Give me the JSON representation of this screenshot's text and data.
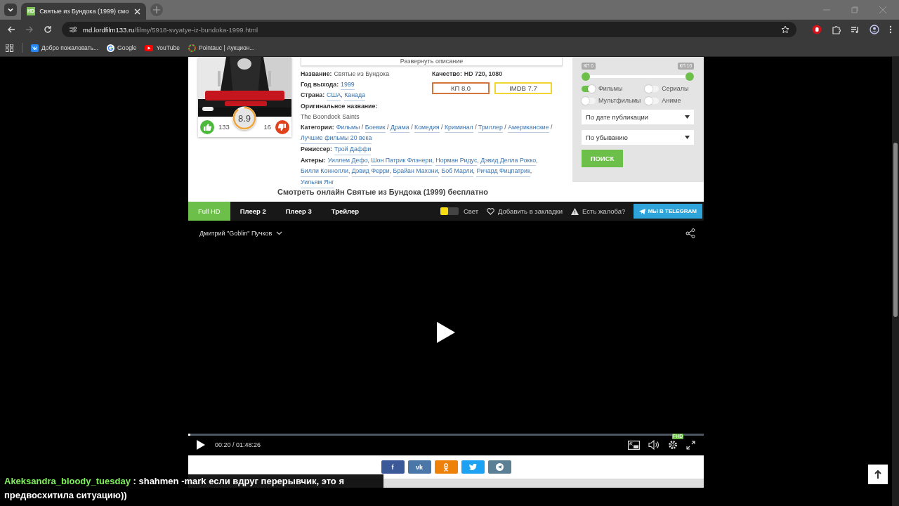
{
  "browser": {
    "tab_title": "Святые из Бундока (1999) смо",
    "tab_favicon": "HD",
    "url_host": "md.lordfilm133.ru",
    "url_path": "/filmy/5918-svyatye-iz-bundoka-1999.html",
    "bookmarks": [
      {
        "label": "Добро пожаловать...",
        "kind": "vk"
      },
      {
        "label": "Google",
        "kind": "google"
      },
      {
        "label": "YouTube",
        "kind": "youtube"
      },
      {
        "label": "Pointauc | Аукцион...",
        "kind": "wheel"
      }
    ]
  },
  "expand_button": "Развернуть описание",
  "poster": {
    "rating": "8.9",
    "likes": "133",
    "dislikes": "16"
  },
  "info": {
    "main_rows": [
      {
        "label": "Название:",
        "value": "Святые из Бундока"
      },
      {
        "label": "Год выхода:",
        "links": [
          "1999"
        ]
      },
      {
        "label": "Страна:",
        "links": [
          "США",
          "Канада"
        ],
        "separator": ", "
      },
      {
        "label": "Оригинальное название:",
        "value": "The Boondock Saints"
      }
    ],
    "quality_label": "Качество:",
    "quality": "HD 720, 1080",
    "ratings": [
      {
        "label": "КП 8.0",
        "color": "#d2763d"
      },
      {
        "label": "IMDB 7.7",
        "color": "#f0d632"
      }
    ],
    "extra_rows": [
      {
        "label": "Категории:",
        "links": [
          "Фильмы",
          "Боевик",
          "Драма",
          "Комедия",
          "Криминал",
          "Триллер",
          "Американские",
          "Лучшие фильмы 20 века"
        ],
        "separator": " / "
      },
      {
        "label": "Режиссер:",
        "links": [
          "Трой Даффи"
        ]
      },
      {
        "label": "Актеры:",
        "links": [
          "Уиллем Дефо",
          "Шон Патрик Флэнери",
          "Норман Ридус",
          "Дэвид Делла Рокко",
          "Билли Коннолли",
          "Дэвид Ферри",
          "Брайан Махони",
          "Боб Марли",
          "Ричард Фицпатрик",
          "Уильям Янг"
        ],
        "separator": ", "
      }
    ]
  },
  "filter": {
    "range": {
      "min_label": "КП 0",
      "max_label": "КП 10",
      "thumbs": [
        {
          "level": 0
        },
        {
          "level": 1
        }
      ]
    },
    "toggles": [
      {
        "label": "Фильмы",
        "on": true
      },
      {
        "label": "Сериалы",
        "on": false
      },
      {
        "label": "Мультфильмы",
        "on": false
      },
      {
        "label": "Аниме",
        "on": false
      }
    ],
    "selects": [
      "По дате публикации",
      "По убыванию"
    ],
    "button": "ПОИСК"
  },
  "page_title": "Смотреть онлайн Святые из Бундока (1999) бесплатно",
  "player": {
    "tabs": [
      {
        "label": "Full HD",
        "selected": true
      },
      {
        "label": "Плеер 2",
        "selected": false
      },
      {
        "label": "Плеер 3",
        "selected": false
      },
      {
        "label": "Трейлер",
        "selected": false
      }
    ],
    "light": {
      "label": "Свет",
      "on": false
    },
    "bookmark": "Добавить в закладки",
    "complaint": "Есть жалоба?",
    "telegram": "МЫ В TELEGRAM",
    "voice": "Дмитрий \"Goblin\" Пучков",
    "time": "00:20 / 01:48:26",
    "progress": {
      "level": 0.004
    },
    "quality_badge": "FHD"
  },
  "share": [
    {
      "kind": "facebook",
      "glyph": "f",
      "color": "#3b5998"
    },
    {
      "kind": "vk",
      "glyph": "vk",
      "color": "#4a76a8"
    },
    {
      "kind": "odnoklassniki",
      "color": "#ee8208"
    },
    {
      "kind": "twitter",
      "color": "#1da1f2"
    },
    {
      "kind": "telegram",
      "color": "#5b7f95"
    }
  ],
  "chat": {
    "user": "Akeksandra_bloody_tuesday",
    "message": ": shahmen -mark если вдруг перерывчик, это я предвосхитила ситуацию))"
  }
}
